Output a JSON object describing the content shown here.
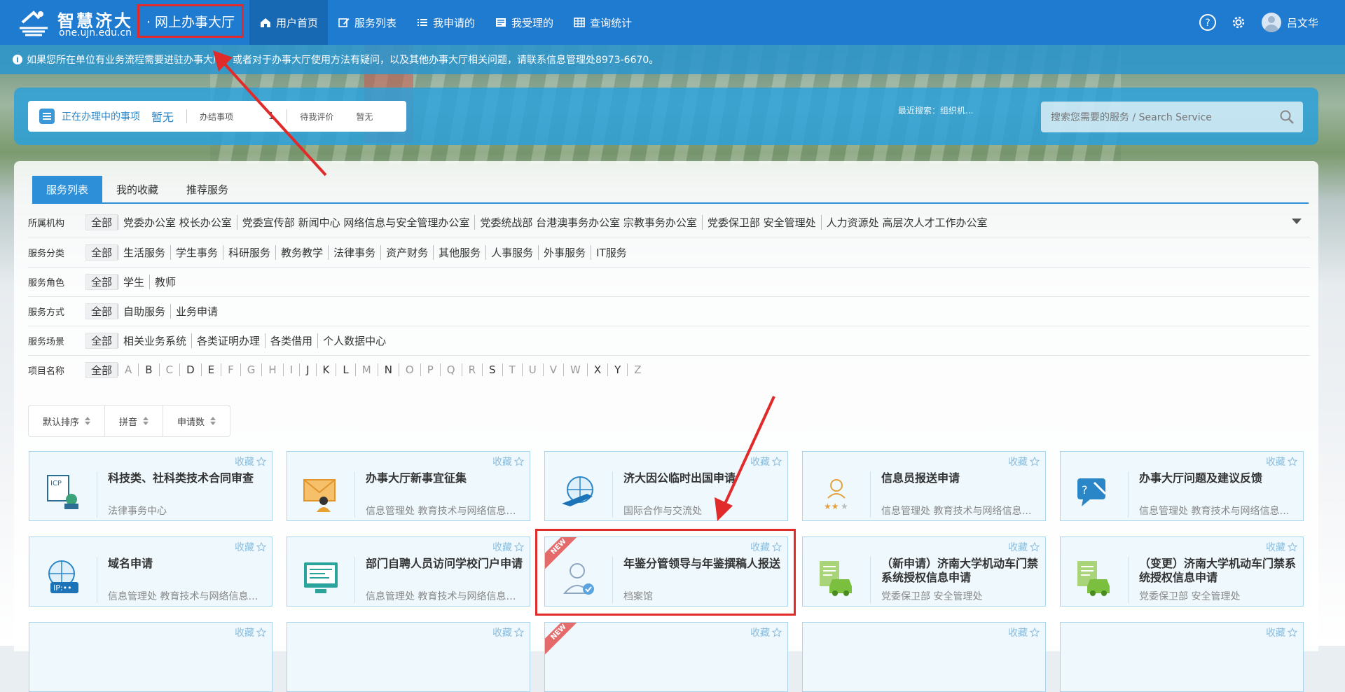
{
  "header": {
    "logo_title": "智慧济大",
    "logo_subtitle": "one.ujn.edu.cn",
    "hall_title": "· 网上办事大厅",
    "nav": [
      {
        "label": "用户首页",
        "icon": "home-icon"
      },
      {
        "label": "服务列表",
        "icon": "edit-icon"
      },
      {
        "label": "我申请的",
        "icon": "list-icon"
      },
      {
        "label": "我受理的",
        "icon": "inbox-icon"
      },
      {
        "label": "查询统计",
        "icon": "table-icon"
      }
    ],
    "user_name": "吕文华"
  },
  "notice": {
    "text": "如果您所在单位有业务流程需要进驻办事大厅，或者对于办事大厅使用方法有疑问，以及其他办事大厅相关问题，请联系信息管理处8973-6670。"
  },
  "status": {
    "label": "正在办理中的事项",
    "value": "暂无",
    "done_label": "办结事项",
    "done_value": "1",
    "eval_label": "待我评价",
    "eval_value": "暂无"
  },
  "recent_search": {
    "label": "最近搜索：",
    "term": "组织机..."
  },
  "search": {
    "placeholder": "搜索您需要的服务 / Search Service"
  },
  "tabs": [
    "服务列表",
    "我的收藏",
    "推荐服务"
  ],
  "filters": {
    "org": {
      "label": "所属机构",
      "options": [
        "全部",
        "党委办公室 校长办公室",
        "党委宣传部 新闻中心 网络信息与安全管理办公室",
        "党委统战部 台港澳事务办公室 宗教事务办公室",
        "党委保卫部 安全管理处",
        "人力资源处 高层次人才工作办公室"
      ]
    },
    "category": {
      "label": "服务分类",
      "options": [
        "全部",
        "生活服务",
        "学生事务",
        "科研服务",
        "教务教学",
        "法律事务",
        "资产财务",
        "其他服务",
        "人事服务",
        "外事服务",
        "IT服务"
      ]
    },
    "role": {
      "label": "服务角色",
      "options": [
        "全部",
        "学生",
        "教师"
      ]
    },
    "mode": {
      "label": "服务方式",
      "options": [
        "全部",
        "自助服务",
        "业务申请"
      ]
    },
    "scene": {
      "label": "服务场景",
      "options": [
        "全部",
        "相关业务系统",
        "各类证明办理",
        "各类借用",
        "个人数据中心"
      ]
    },
    "name": {
      "label": "项目名称",
      "options": [
        "全部",
        "A",
        "B",
        "C",
        "D",
        "E",
        "F",
        "G",
        "H",
        "I",
        "J",
        "K",
        "L",
        "M",
        "N",
        "O",
        "P",
        "Q",
        "R",
        "S",
        "T",
        "U",
        "V",
        "W",
        "X",
        "Y",
        "Z"
      ]
    }
  },
  "sort": [
    "默认排序",
    "拼音",
    "申请数"
  ],
  "fav_label": "收藏",
  "new_label": "NEW",
  "cards": [
    {
      "title": "科技类、社科类技术合同审查",
      "dept": "法律事务中心",
      "icon": "contract-icon"
    },
    {
      "title": "办事大厅新事宜征集",
      "dept": "信息管理处 教育技术与网络信息中心",
      "icon": "mail-person-icon"
    },
    {
      "title": "济大因公临时出国申请",
      "dept": "国际合作与交流处",
      "icon": "globe-plane-icon"
    },
    {
      "title": "信息员报送申请",
      "dept": "信息管理处 教育技术与网络信息中心",
      "icon": "person-stars-icon"
    },
    {
      "title": "办事大厅问题及建议反馈",
      "dept": "信息管理处 教育技术与网络信息中心",
      "icon": "chat-question-icon"
    },
    {
      "title": "域名申请",
      "dept": "信息管理处 教育技术与网络信息中心",
      "icon": "globe-ip-icon"
    },
    {
      "title": "部门自聘人员访问学校门户申请",
      "dept": "信息管理处 教育技术与网络信息中心",
      "icon": "monitor-icon"
    },
    {
      "title": "年鉴分管领导与年鉴撰稿人报送",
      "dept": "档案馆",
      "icon": "user-check-icon"
    },
    {
      "title": "（新申请）济南大学机动车门禁系统授权信息申请",
      "dept": "党委保卫部 安全管理处",
      "icon": "car-doc-icon"
    },
    {
      "title": "（变更）济南大学机动车门禁系统授权信息申请",
      "dept": "党委保卫部 安全管理处",
      "icon": "car-doc-icon"
    }
  ]
}
